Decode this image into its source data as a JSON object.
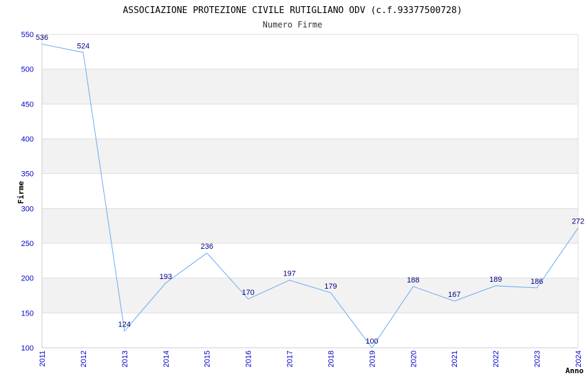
{
  "chart_data": {
    "type": "line",
    "title": "ASSOCIAZIONE PROTEZIONE CIVILE RUTIGLIANO ODV (c.f.93377500728)",
    "subtitle": "Numero Firme",
    "xlabel": "Anno",
    "ylabel": "Firme",
    "x": [
      "2011",
      "2012",
      "2013",
      "2014",
      "2015",
      "2016",
      "2017",
      "2018",
      "2019",
      "2020",
      "2021",
      "2022",
      "2023",
      "2024"
    ],
    "values": [
      536,
      524,
      124,
      193,
      236,
      170,
      197,
      179,
      100,
      188,
      167,
      189,
      186,
      272
    ],
    "ylim": [
      100,
      550
    ],
    "yticks": [
      100,
      150,
      200,
      250,
      300,
      350,
      400,
      450,
      500,
      550
    ],
    "grid": true,
    "colors": {
      "line": "#6aaaf0",
      "band": "#f2f2f2",
      "tick_text": "#0000cc",
      "data_label": "#000080"
    }
  }
}
